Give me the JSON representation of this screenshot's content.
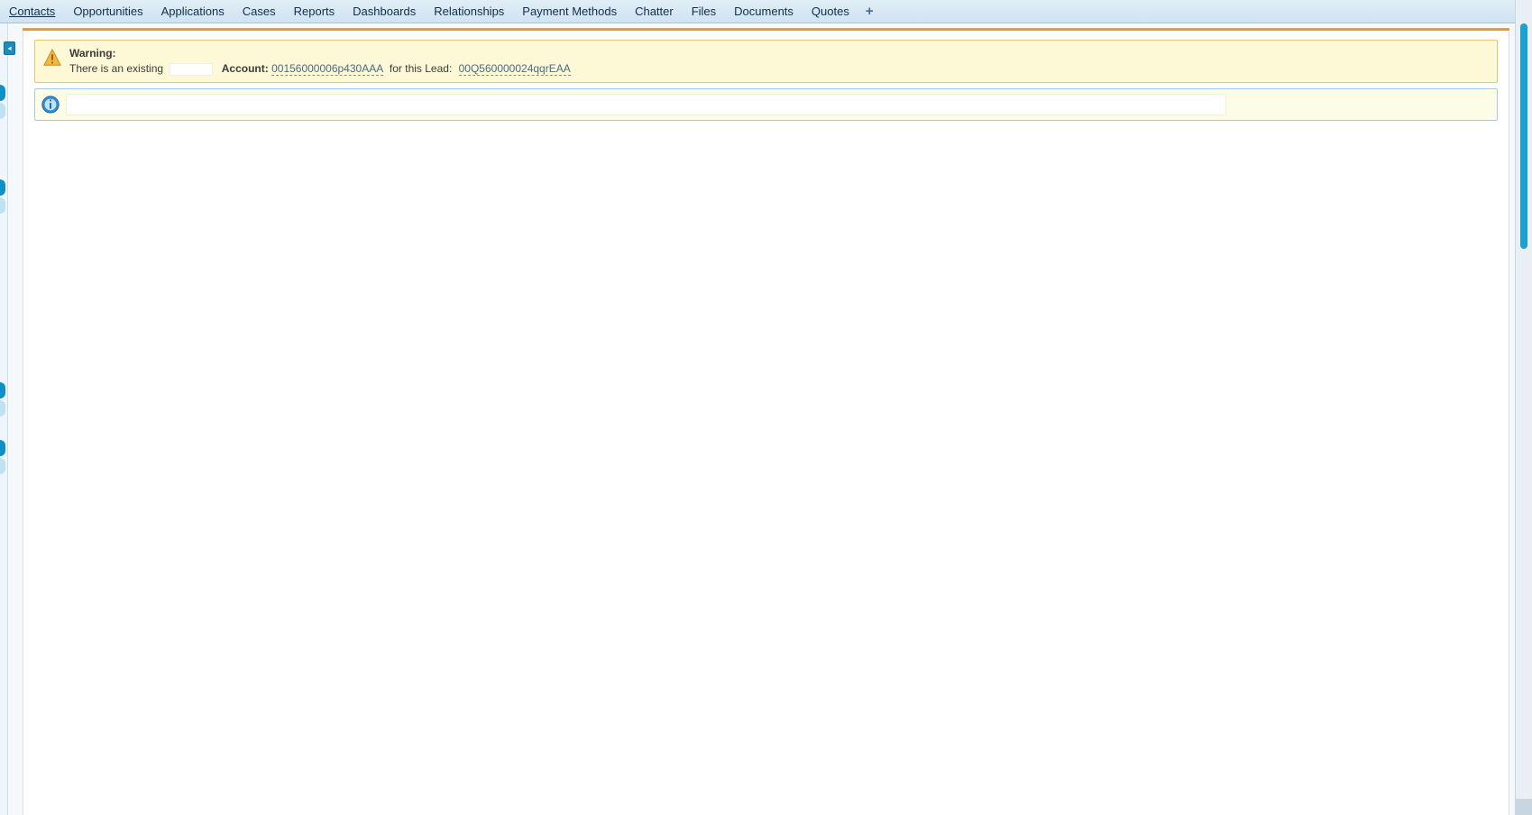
{
  "nav": {
    "tabs": [
      "Contacts",
      "Opportunities",
      "Applications",
      "Cases",
      "Reports",
      "Dashboards",
      "Relationships",
      "Payment Methods",
      "Chatter",
      "Files",
      "Documents",
      "Quotes"
    ],
    "plus": "+"
  },
  "sidebar": {
    "collapse_arrow": "◂"
  },
  "warning": {
    "title": "Warning:",
    "line_prefix": "There is an existing",
    "account_label": "Account:",
    "account_id": "00156000006p430AAA",
    "mid_text": "for this Lead:",
    "lead_id": "00Q560000024qqrEAA"
  },
  "info": {
    "message": ""
  }
}
